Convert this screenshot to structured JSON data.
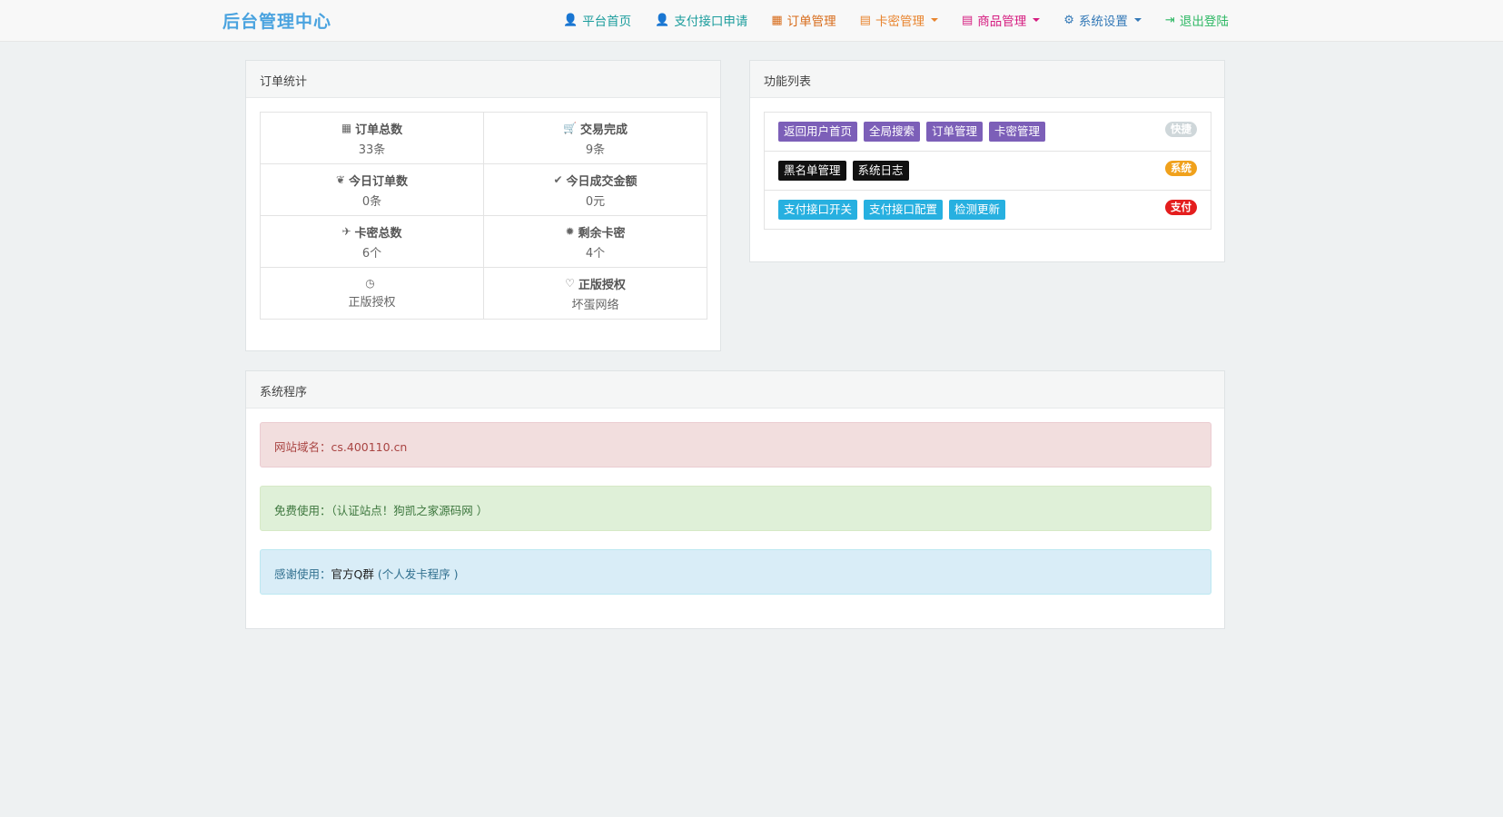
{
  "navbar": {
    "brand": "后台管理中心",
    "items": [
      {
        "label": "平台首页",
        "icon": "user-icon",
        "color": "#1a9c9c"
      },
      {
        "label": "支付接口申请",
        "icon": "user-icon",
        "color": "#1a9c9c"
      },
      {
        "label": "订单管理",
        "icon": "calendar-icon",
        "color": "#d76a18"
      },
      {
        "label": "卡密管理",
        "icon": "list-icon",
        "color": "#e8842e"
      },
      {
        "label": "商品管理",
        "icon": "list-icon",
        "color": "#d51b7f"
      },
      {
        "label": "系统设置",
        "icon": "gear-icon",
        "color": "#3479b7"
      },
      {
        "label": "退出登陆",
        "icon": "logout-icon",
        "color": "#2fb865"
      }
    ]
  },
  "order_stats": {
    "title": "订单统计",
    "cells": [
      {
        "label": "订单总数",
        "value": "33条",
        "icon": "grid-icon"
      },
      {
        "label": "交易完成",
        "value": "9条",
        "icon": "cart-icon"
      },
      {
        "label": "今日订单数",
        "value": "0条",
        "icon": "leaf-icon"
      },
      {
        "label": "今日成交金额",
        "value": "0元",
        "icon": "check-icon"
      },
      {
        "label": "卡密总数",
        "value": "6个",
        "icon": "plane-icon"
      },
      {
        "label": "剩余卡密",
        "value": "4个",
        "icon": "certificate-icon"
      },
      {
        "label": "",
        "value": "正版授权",
        "icon": "dashboard-icon"
      },
      {
        "label": "正版授权",
        "value": "坏蛋网络",
        "icon": "heart-icon"
      }
    ]
  },
  "function_list": {
    "title": "功能列表",
    "rows": [
      {
        "buttons": [
          "返回用户首页",
          "全局搜索",
          "订单管理",
          "卡密管理"
        ],
        "badge": "快捷"
      },
      {
        "buttons": [
          "黑名单管理",
          "系统日志"
        ],
        "badge": "系统"
      },
      {
        "buttons": [
          "支付接口开关",
          "支付接口配置",
          "检测更新"
        ],
        "badge": "支付"
      }
    ]
  },
  "system_program": {
    "title": "系统程序",
    "domain_label": "网站域名：",
    "domain_value": "cs.400110.cn",
    "free_text": "免费使用：（认证站点！狗凯之家源码网 ）",
    "thanks_label": "感谢使用：",
    "thanks_link": "官方Q群",
    "thanks_suffix": " (个人发卡程序 )"
  },
  "colors": {
    "brand": "#4aa3df",
    "tag_purple": "#7c5fb8",
    "tag_black": "#111111",
    "tag_cyan": "#27b0e0",
    "badge_gray": "#cfd7da",
    "badge_orange": "#f0a11c",
    "badge_red": "#e41e1e"
  }
}
